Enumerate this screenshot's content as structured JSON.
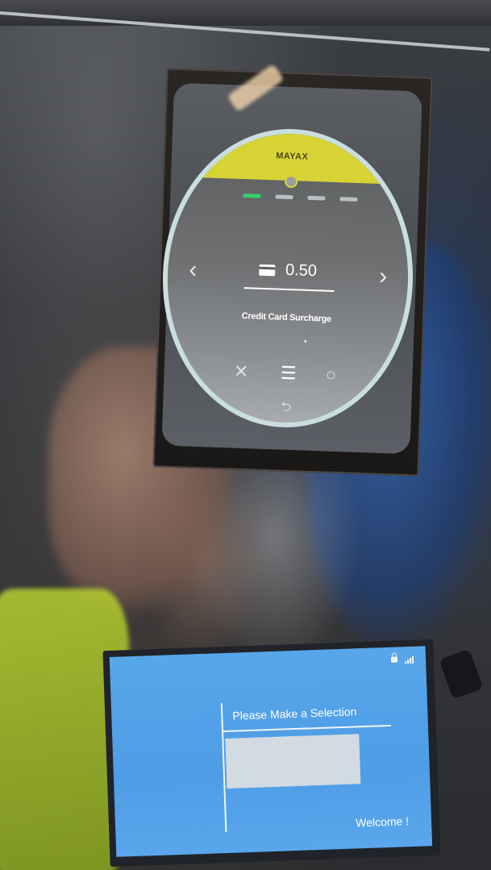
{
  "card_reader": {
    "brand": "MAYAX",
    "amount": "0.50",
    "amount_label": "Credit Card Surcharge",
    "prev_glyph": "‹",
    "next_glyph": "›",
    "cancel_glyph": "✕",
    "menu_glyph": "☰",
    "ok_glyph": "○",
    "back_glyph": "⮌",
    "progress_steps": 4,
    "progress_active": 1,
    "icons": [
      "credit-card-icon",
      "chevron-left-icon",
      "chevron-right-icon",
      "close-icon",
      "menu-icon",
      "circle-ok-icon",
      "back-icon"
    ]
  },
  "lcd": {
    "title": "Please Make a Selection",
    "footer": "Welcome !",
    "icons": [
      "lock-icon",
      "signal-icon"
    ]
  },
  "colors": {
    "brand_band": "#d8d335",
    "progress_active": "#34d06a",
    "display_ring": "#c9dede",
    "lcd_background": "#58a6ea"
  }
}
